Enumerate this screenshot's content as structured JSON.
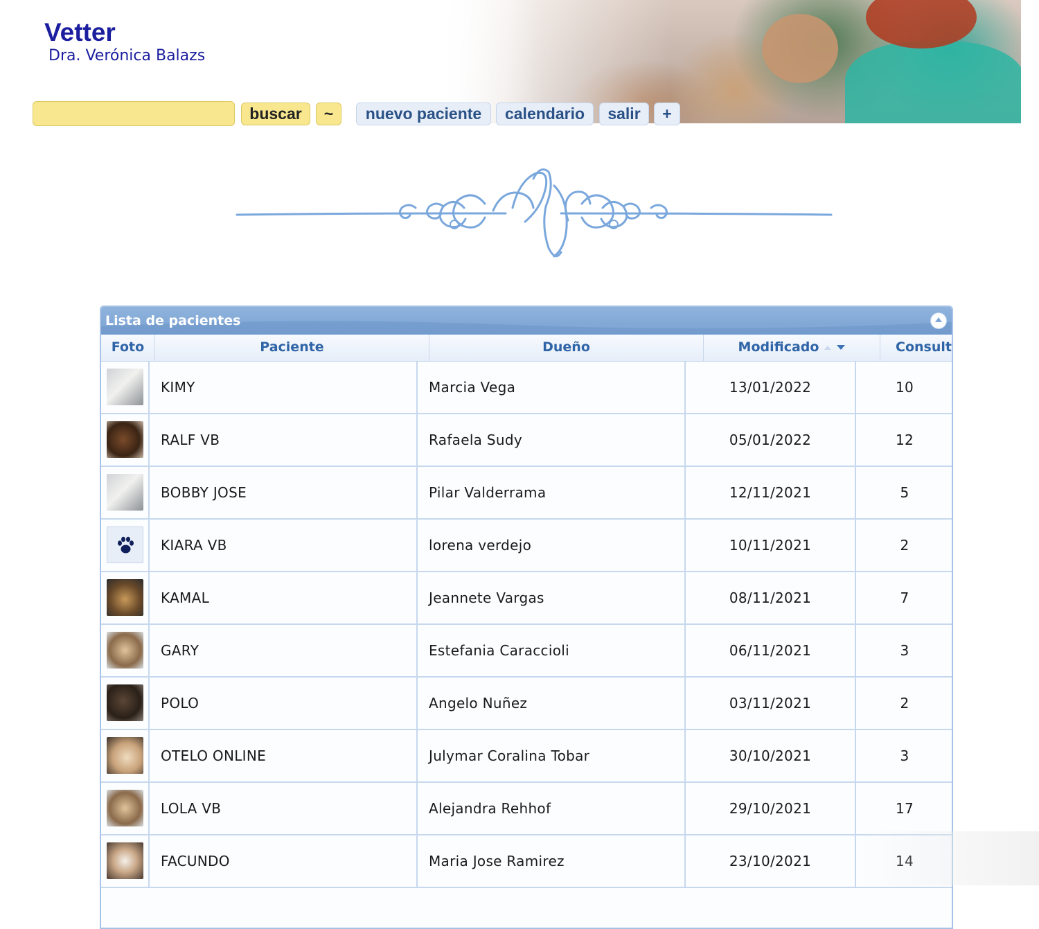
{
  "brand": {
    "title": "Vetter",
    "subtitle": "Dra. Verónica Balazs"
  },
  "toolbar": {
    "search": {
      "value": "",
      "placeholder": ""
    },
    "buscar_label": "buscar",
    "tilde_label": "~",
    "nuevo_paciente_label": "nuevo paciente",
    "calendario_label": "calendario",
    "salir_label": "salir",
    "plus_label": "+"
  },
  "grid": {
    "caption": "Lista de pacientes",
    "columns": {
      "foto": "Foto",
      "paciente": "Paciente",
      "dueno": "Dueño",
      "modificado": "Modificado",
      "consultas": "Consultas"
    },
    "sort": {
      "column": "Modificado",
      "direction": "descending"
    },
    "rows": [
      {
        "foto": "white-dog-photo",
        "paciente": "KIMY",
        "dueno": "Marcia Vega",
        "modificado": "13/01/2022",
        "consultas": "10"
      },
      {
        "foto": "brown-dog-photo",
        "paciente": "RALF VB",
        "dueno": "Rafaela Sudy",
        "modificado": "05/01/2022",
        "consultas": "12"
      },
      {
        "foto": "white-dog-photo",
        "paciente": "BOBBY JOSE",
        "dueno": "Pilar Valderrama",
        "modificado": "12/11/2021",
        "consultas": "5"
      },
      {
        "foto": "paw-icon",
        "paciente": "KIARA VB",
        "dueno": "lorena verdejo",
        "modificado": "10/11/2021",
        "consultas": "2"
      },
      {
        "foto": "golden-dog-photo",
        "paciente": "KAMAL",
        "dueno": "Jeannete Vargas",
        "modificado": "08/11/2021",
        "consultas": "7"
      },
      {
        "foto": "tan-dog-photo",
        "paciente": "GARY",
        "dueno": "Estefania Caraccioli",
        "modificado": "06/11/2021",
        "consultas": "3"
      },
      {
        "foto": "dark-dog-photo",
        "paciente": "POLO",
        "dueno": "Angelo Nuñez",
        "modificado": "03/11/2021",
        "consultas": "2"
      },
      {
        "foto": "fluffy-dog-photo",
        "paciente": "OTELO ONLINE",
        "dueno": "Julymar Coralina Tobar",
        "modificado": "30/10/2021",
        "consultas": "3"
      },
      {
        "foto": "tan-dog-photo",
        "paciente": "LOLA VB",
        "dueno": "Alejandra Rehhof",
        "modificado": "29/10/2021",
        "consultas": "17"
      },
      {
        "foto": "bulldog-photo",
        "paciente": "FACUNDO",
        "dueno": "Maria Jose Ramirez",
        "modificado": "23/10/2021",
        "consultas": "14"
      }
    ]
  },
  "colors": {
    "brand": "#1b1e9e",
    "search_bg": "#f8e78e",
    "button_blue_bg": "#e7eef8",
    "button_blue_text": "#2a5186",
    "grid_header": "#7aa2d2",
    "grid_border": "#a6c3e6",
    "column_header_text": "#2f64a6",
    "ornament": "#7aa7dc"
  }
}
